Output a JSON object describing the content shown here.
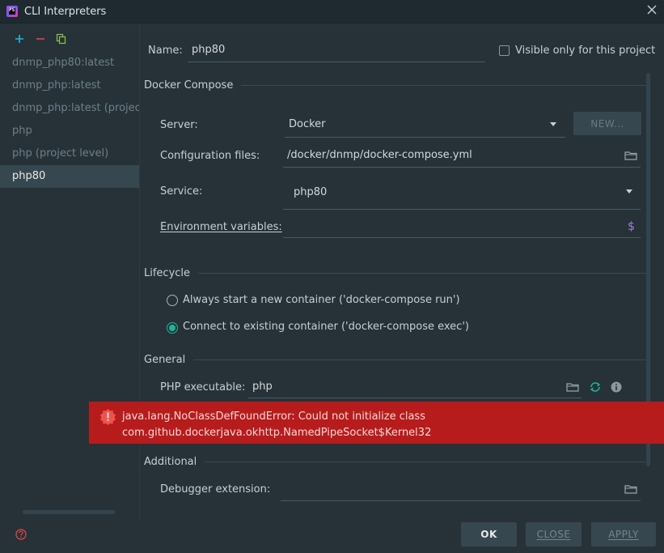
{
  "window": {
    "title": "CLI Interpreters",
    "app_icon_text": "PS"
  },
  "sidebar": {
    "items": [
      {
        "label": "dnmp_php80:latest",
        "selected": false
      },
      {
        "label": "dnmp_php:latest",
        "selected": false
      },
      {
        "label": "dnmp_php:latest (project level)",
        "selected": false
      },
      {
        "label": "php",
        "selected": false
      },
      {
        "label": "php (project level)",
        "selected": false
      },
      {
        "label": "php80",
        "selected": true
      }
    ]
  },
  "form": {
    "name_label": "Name:",
    "name_value": "php80",
    "visible_only_label": "Visible only for this project",
    "visible_only_checked": false,
    "docker_compose_header": "Docker Compose",
    "server_label": "Server:",
    "server_value": "Docker",
    "new_button": "NEW...",
    "config_files_label": "Configuration files:",
    "config_files_value": "/docker/dnmp/docker-compose.yml",
    "service_label": "Service:",
    "service_value": "php80",
    "env_vars_label": "Environment variables:",
    "env_vars_value": "",
    "env_icon": "$",
    "lifecycle_header": "Lifecycle",
    "lifecycle_option_run": "Always start a new container ('docker-compose run')",
    "lifecycle_option_exec": "Connect to existing container ('docker-compose exec')",
    "lifecycle_selected": "exec",
    "general_header": "General",
    "php_exec_label": "PHP executable:",
    "php_exec_value": "php",
    "additional_header": "Additional",
    "debugger_ext_label": "Debugger extension:",
    "debugger_ext_value": ""
  },
  "error": {
    "line1": "java.lang.NoClassDefFoundError: Could not initialize class",
    "line2": "com.github.dockerjava.okhttp.NamedPipeSocket$Kernel32"
  },
  "footer": {
    "ok_label": "OK",
    "close_label": "CLOSE",
    "apply_label": "APPLY"
  },
  "colors": {
    "background": "#263238",
    "accent": "#1eb59a",
    "error": "#b71c1c",
    "add_icon": "#21b6e6",
    "remove_icon": "#e04545",
    "copy_icon": "#8bc34a"
  }
}
